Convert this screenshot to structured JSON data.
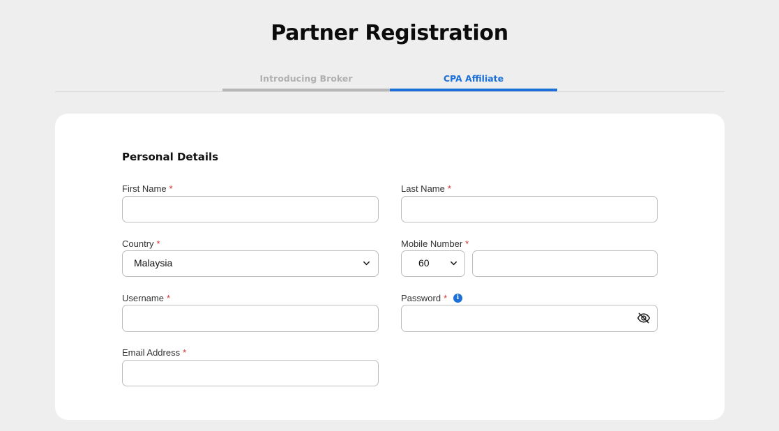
{
  "page": {
    "title": "Partner Registration"
  },
  "tabs": [
    {
      "label": "Introducing Broker",
      "active": false
    },
    {
      "label": "CPA Affiliate",
      "active": true
    }
  ],
  "form": {
    "section_title": "Personal Details",
    "required_mark": "*",
    "first_name": {
      "label": "First Name",
      "value": ""
    },
    "last_name": {
      "label": "Last Name",
      "value": ""
    },
    "country": {
      "label": "Country",
      "value": "Malaysia"
    },
    "mobile": {
      "label": "Mobile Number",
      "code": "60",
      "value": ""
    },
    "username": {
      "label": "Username",
      "value": ""
    },
    "password": {
      "label": "Password",
      "value": ""
    },
    "email": {
      "label": "Email Address",
      "value": ""
    }
  },
  "icons": {
    "info": "info-icon",
    "eye": "eye-off-icon",
    "chevron": "chevron-down-icon"
  },
  "colors": {
    "accent": "#1a6fd8",
    "required": "#d0312d",
    "inactive_tab": "#b0b0b0"
  }
}
